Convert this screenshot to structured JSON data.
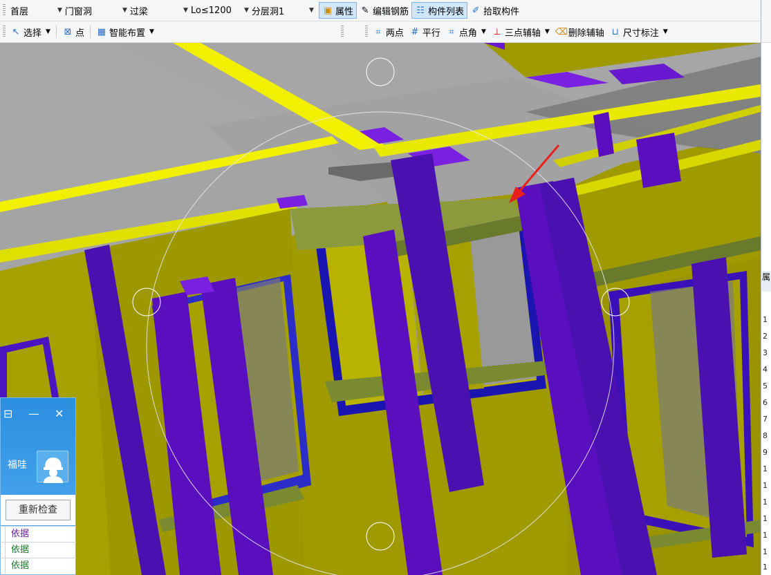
{
  "toolbar1": {
    "floor": "首层",
    "category": "门窗洞",
    "component_type": "过梁",
    "component_name": "Lo≤1200",
    "layer": "分层洞1",
    "properties": "属性",
    "edit_rebar": "编辑钢筋",
    "component_list": "构件列表",
    "pick_component": "拾取构件"
  },
  "toolbar2": {
    "select": "选择",
    "point": "点",
    "smart_place": "智能布置",
    "two_points": "两点",
    "parallel": "平行",
    "point_angle": "点角",
    "three_point_axis": "三点辅轴",
    "delete_axis": "删除辅轴",
    "dimension": "尺寸标注"
  },
  "right_panel": {
    "title": "属",
    "row_numbers": [
      "1",
      "2",
      "3",
      "4",
      "5",
      "6",
      "7",
      "8",
      "9",
      "1",
      "1",
      "1",
      "1",
      "1",
      "1",
      "1"
    ]
  },
  "chat": {
    "name": "福哇",
    "recheck_button": "重新检查",
    "basis_rows": [
      "依据",
      "依据",
      "依据"
    ]
  },
  "colors": {
    "wall_yellow": "#a6a000",
    "column_purple": "#5a0fbf",
    "slab_gray": "#a8a8a8",
    "lintel_green": "#8a9a3c",
    "beam_yellow": "#f0f000",
    "window_blue": "#0000b4",
    "arrow_red": "#e8201a"
  }
}
